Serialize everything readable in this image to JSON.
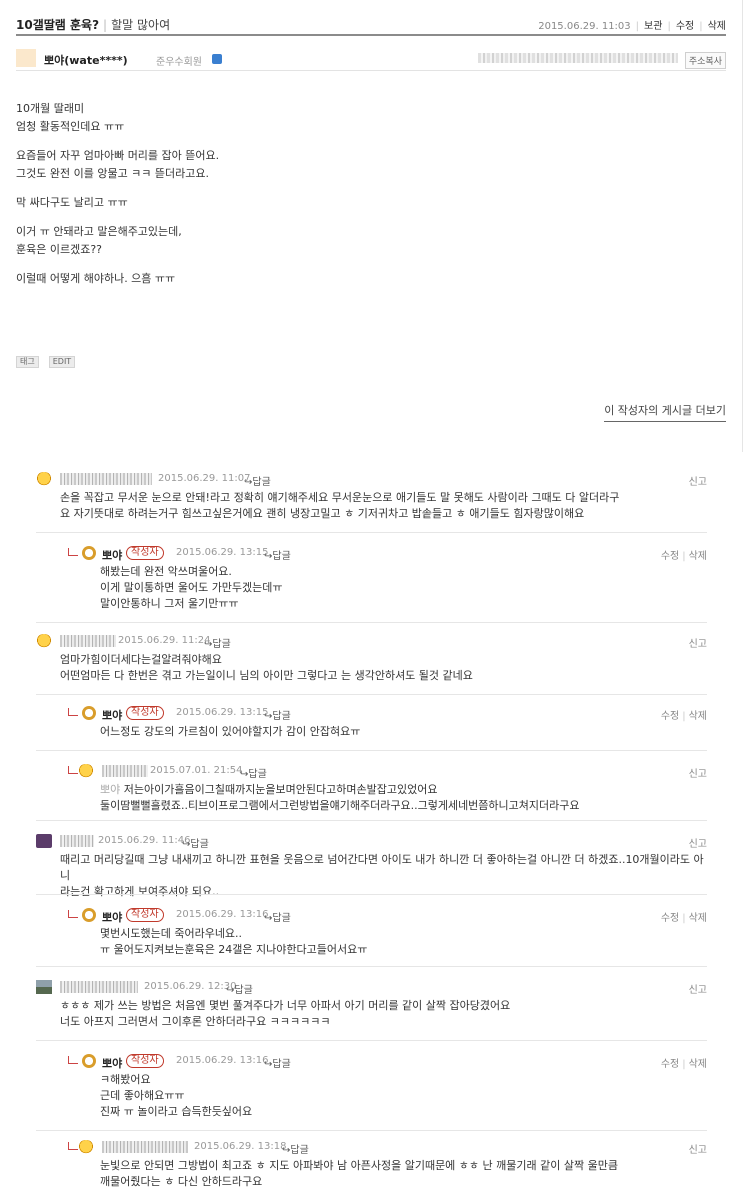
{
  "post": {
    "title": "10갤딸램 훈육?",
    "category": "할말 많아여",
    "date": "2015.06.29. 11:03",
    "actions": [
      "보관",
      "수정",
      "삭제"
    ],
    "author": "뽀야(wate****)",
    "grade": "준우수회원",
    "address_copy": "주소복사",
    "body": [
      "10개월 딸래미",
      "엄청 활동적인데요 ㅠㅠ",
      "",
      "요즘들어 자꾸 엄마아빠 머리를 잡아 뜯어요.",
      "그것도 완전 이를 앙물고 ㅋㅋ 뜯더라고요.",
      "",
      "막 싸다구도 날리고 ㅠㅠ",
      "",
      "이거 ㅠ 안돼라고 말은해주고있는데,",
      "훈육은 이르겠죠??",
      "",
      "이럴때 어떻게 해야하나. 으흠 ㅠㅠ"
    ],
    "tag_label": "태그",
    "edit_label": "EDIT",
    "more_posts": "이 작성자의 게시글 더보기"
  },
  "labels": {
    "reply": "↪답글",
    "report": "신고",
    "edit": "수정",
    "delete": "삭제",
    "writer": "작성자",
    "op_nick": "뽀야"
  },
  "comments": [
    {
      "date": "2015.06.29. 11:07",
      "lines": [
        "손을 꼭잡고 무서운 눈으로 안돼!라고 정확히 얘기해주세요 무서운눈으로 애기들도 말 못해도 사람이라 그때도 다 알더라구",
        "요 자기뜻대로 하려는거구 힘쓰고싶은거에요 괜히 냉장고밀고 ㅎ 기저귀차고 밥솥들고 ㅎ 애기들도 힘자랑많이해요"
      ]
    },
    {
      "date": "2015.06.29. 13:15",
      "lines": [
        "해봤는데 완전 악쓰며울어요.",
        "이게 말이통하면 울어도 가만두겠는데ㅠ",
        "말이안통하니 그저 울기만ㅠㅠ"
      ]
    },
    {
      "date": "2015.06.29. 11:24",
      "lines": [
        "엄마가힘이더세다는걸알려줘야해요",
        "어떤엄마든 다 한번은 겪고 가는일이니 님의 아이만 그렇다고 는 생각안하셔도 될것 같네요"
      ]
    },
    {
      "date": "2015.06.29. 13:15",
      "lines": [
        "어느정도 강도의 가르침이 있어야할지가 감이 안잡혀요ㅠ"
      ]
    },
    {
      "date": "2015.07.01. 21:54",
      "lines": [
        "저는아이가흘음이그칠때까지눈을보며안된다고하며손발잡고있었어요",
        "둘이땀뻘뻘흘렸죠..티브이프로그램에서그런방법을얘기해주더라구요..그렇게세네번쯤하니고쳐지더라구요"
      ]
    },
    {
      "date": "2015.06.29. 11:46",
      "lines": [
        "때리고 머리당길때 그냥 내새끼고 하니깐 표현을 웃음으로 넘어간다면 아이도 내가 하니깐 더 좋아하는걸 아니깐 더 하겠죠..10개월이라도 아니",
        "라는건 확고하게 보여주셔야 되요.."
      ]
    },
    {
      "date": "2015.06.29. 13:16",
      "lines": [
        "몇번시도했는데 죽어라우네요..",
        "ㅠ 울어도지켜보는훈육은 24갤은 지나야한다고들어서요ㅠ"
      ]
    },
    {
      "date": "2015.06.29. 12:30",
      "lines": [
        "ㅎㅎㅎ 제가 쓰는 방법은 처음엔 몇번 풀겨주다가 너무 아파서 아기 머리를 같이 살짝 잡아당겼어요",
        "너도 아프지 그러면서 그이후론 안하더라구요 ㅋㅋㅋㅋㅋㅋ"
      ]
    },
    {
      "date": "2015.06.29. 13:16",
      "lines": [
        "ㅋ해봤어요",
        "근데 좋아해요ㅠㅠ",
        "진짜 ㅠ 놀이라고 습득한듯싶어요"
      ]
    },
    {
      "date": "2015.06.29. 13:18",
      "lines": [
        "눈빛으로 안되면 그방법이 최고죠 ㅎ 지도 아파봐야 남 아픈사정을 알기때문에 ㅎㅎ 난 깨물기래 같이 살짝 울만큼",
        "깨물어줬다는 ㅎ 다신 안하드라구요"
      ]
    }
  ]
}
